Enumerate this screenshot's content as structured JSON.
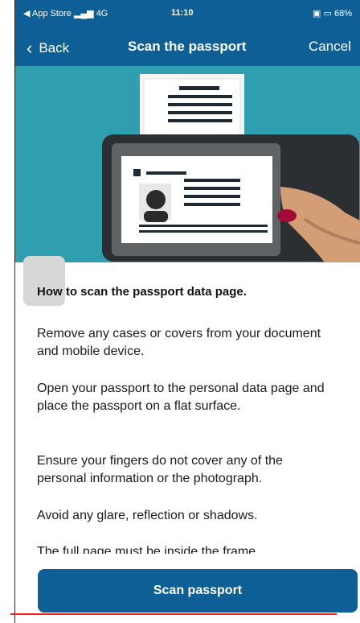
{
  "status": {
    "carrier": "◀ App Store",
    "signal": "4G",
    "time": "11:10",
    "battery": "68%"
  },
  "nav": {
    "back_label": "Back",
    "title": "Scan the passport",
    "cancel_label": "Cancel"
  },
  "content": {
    "intro": "How to scan the passport data page.",
    "steps": [
      "Remove any cases or covers from your document and mobile device.",
      "Open your passport to the personal data page and place the passport on a flat surface.",
      "Ensure your fingers do not cover any of the personal information or the photograph.",
      "Avoid any glare, reflection or shadows.",
      "The full page must be inside the frame."
    ]
  },
  "button": {
    "scan_label": "Scan passport"
  },
  "colors": {
    "brand": "#0d5f95",
    "hero": "#2f9eae",
    "accent_line": "#ff1a1a"
  }
}
